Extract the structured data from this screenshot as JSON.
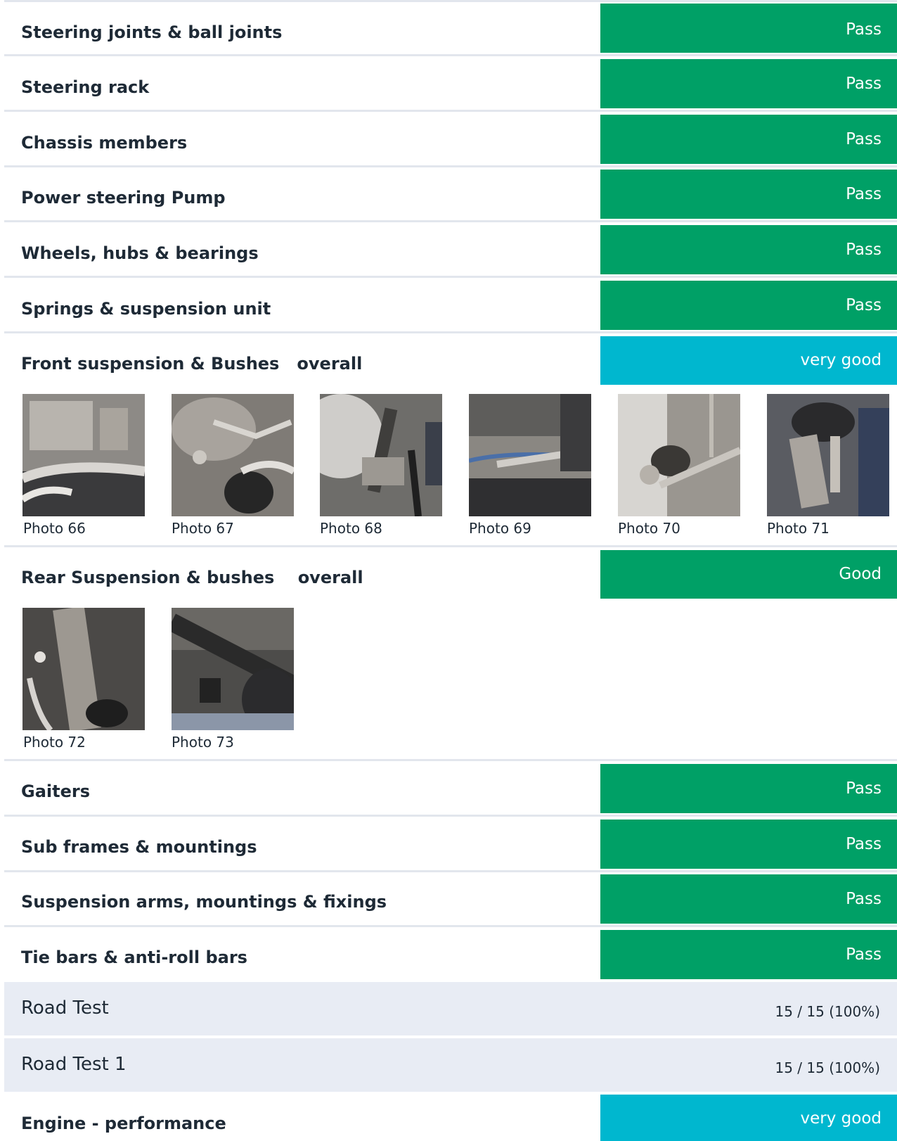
{
  "colors": {
    "pass": "#00a066",
    "rating": "#00b7cf",
    "band": "#e8ecf4",
    "separator": "#e2e6ed"
  },
  "items": [
    {
      "label": "Steering joints & ball joints",
      "status": "Pass"
    },
    {
      "label": "Steering rack",
      "status": "Pass"
    },
    {
      "label": "Chassis members",
      "status": "Pass"
    },
    {
      "label": "Power steering Pump",
      "status": "Pass"
    },
    {
      "label": "Wheels, hubs & bearings",
      "status": "Pass"
    },
    {
      "label": "Springs & suspension unit",
      "status": "Pass"
    },
    {
      "label": "Front suspension & Bushes   overall",
      "status": "very good",
      "photos": [
        "Photo 66",
        "Photo 67",
        "Photo 68",
        "Photo 69",
        "Photo 70",
        "Photo 71"
      ]
    },
    {
      "label": "Rear Suspension & bushes    overall",
      "status": "Good",
      "photos": [
        "Photo 72",
        "Photo 73"
      ]
    },
    {
      "label": "Gaiters",
      "status": "Pass"
    },
    {
      "label": "Sub frames & mountings",
      "status": "Pass"
    },
    {
      "label": "Suspension arms, mountings & fixings",
      "status": "Pass"
    },
    {
      "label": "Tie bars & anti-roll bars",
      "status": "Pass"
    }
  ],
  "sections": [
    {
      "title": "Road Test",
      "score": "15 / 15 (100%)"
    },
    {
      "title": "Road Test 1",
      "score": "15 / 15 (100%)"
    }
  ],
  "engine": {
    "label": "Engine - performance",
    "status": "very good"
  }
}
